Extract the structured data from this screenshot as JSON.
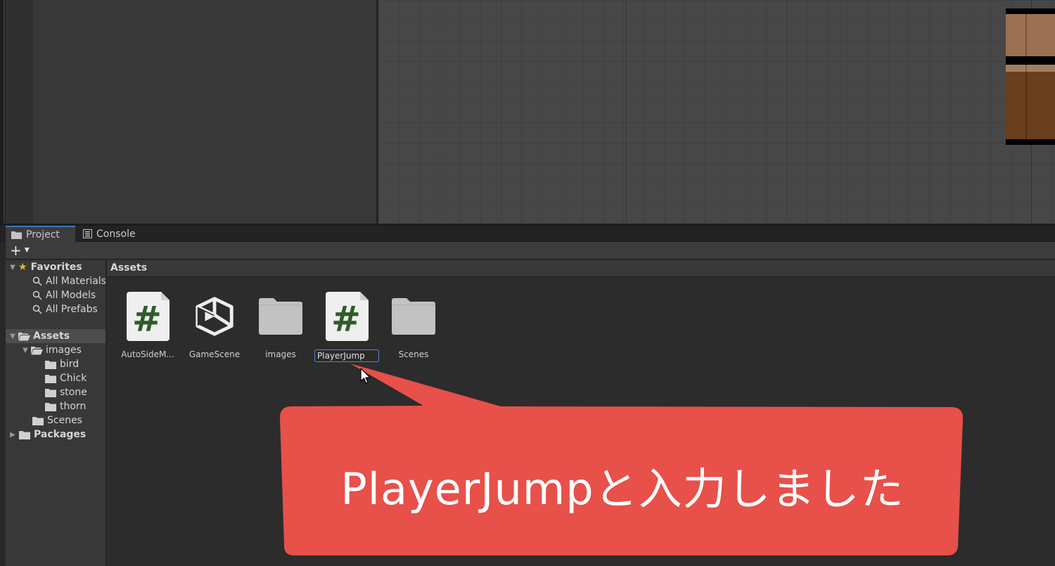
{
  "tabs": [
    {
      "label": "Project",
      "icon": "folder-icon",
      "active": true
    },
    {
      "label": "Console",
      "icon": "console-icon",
      "active": false
    }
  ],
  "toolbar": {
    "add_label": "+"
  },
  "tree": {
    "favorites": {
      "label": "Favorites",
      "items": [
        "All Materials",
        "All Models",
        "All Prefabs"
      ]
    },
    "assets": {
      "label": "Assets",
      "images": {
        "label": "images",
        "children": [
          "bird",
          "Chick",
          "stone",
          "thorn"
        ]
      },
      "scenes": "Scenes"
    },
    "packages": "Packages"
  },
  "breadcrumb": "Assets",
  "assets": [
    {
      "label": "AutoSideM...",
      "icon": "csharp-script-icon"
    },
    {
      "label": "GameScene",
      "icon": "unity-scene-icon"
    },
    {
      "label": "images",
      "icon": "folder-icon"
    },
    {
      "label": "PlayerJump",
      "icon": "csharp-script-icon",
      "renaming": true
    },
    {
      "label": "Scenes",
      "icon": "folder-icon"
    }
  ],
  "callout": {
    "text": "PlayerJumpと入力しました",
    "color": "#e8504a"
  },
  "colors": {
    "accent": "#3a79bb",
    "script_hash": "#2f5b2b"
  }
}
